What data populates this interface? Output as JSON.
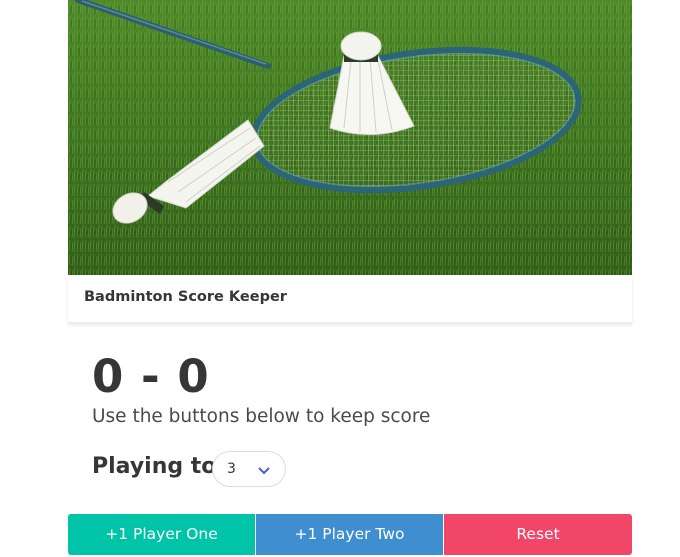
{
  "hero": {
    "alt": "badminton racket and shuttlecocks on grass"
  },
  "header": {
    "title": "Badminton Score Keeper"
  },
  "score": {
    "player_one": "0",
    "separator": "-",
    "player_two": "0",
    "display": "0 - 0"
  },
  "hint_text": "Use the buttons below to keep score",
  "playing_to": {
    "label": "Playing to",
    "selected": "3"
  },
  "buttons": {
    "player_one": "+1 Player One",
    "player_two": "+1 Player Two",
    "reset": "Reset"
  },
  "colors": {
    "player_one": "#00c4a7",
    "player_two": "#3e8ed0",
    "reset": "#f14668",
    "caret": "#485fc7"
  }
}
